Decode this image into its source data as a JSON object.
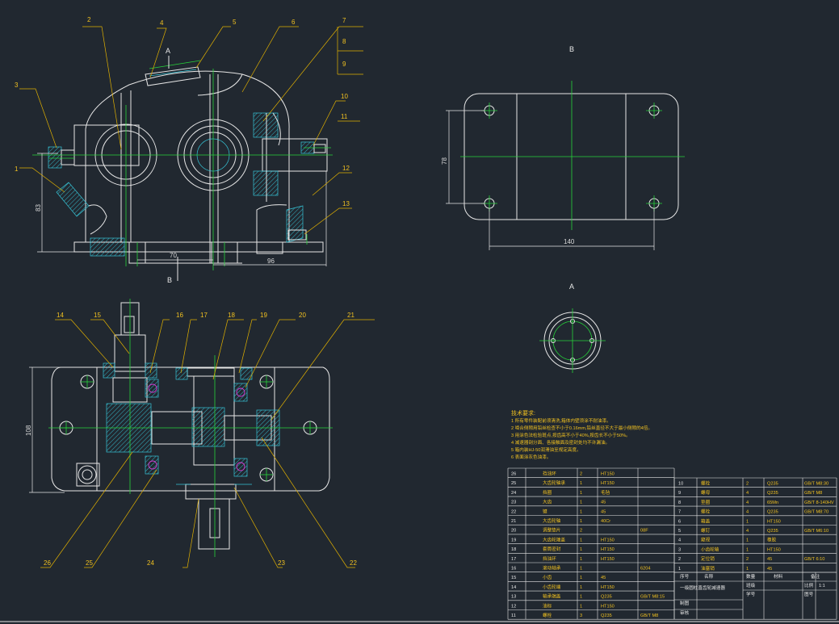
{
  "views": {
    "section_label_a": "A",
    "section_label_b": "B",
    "view_b_title": "B",
    "view_a_title": "A"
  },
  "front_view": {
    "part_numbers": [
      "1",
      "2",
      "3",
      "4",
      "5",
      "6",
      "7",
      "8",
      "9",
      "10",
      "11",
      "12",
      "13"
    ],
    "dimensions": {
      "height": "83",
      "base_left": "70",
      "base_right": "96"
    }
  },
  "view_b": {
    "dimensions": {
      "width": "140",
      "height": "78"
    }
  },
  "top_view": {
    "part_numbers": [
      "14",
      "15",
      "16",
      "17",
      "18",
      "19",
      "20",
      "21",
      "22",
      "23",
      "24",
      "25",
      "26"
    ],
    "dimensions": {
      "height": "108"
    }
  },
  "notes": {
    "title": "技术要求:",
    "lines": [
      "1 所有零件装配前须清洗,箱体内壁须涂不耐油漆。",
      "2 啮合侧隙用铅丝检查不小于0.16mm,铅丝直径不大于最小侧隙的4倍。",
      "3 用涂色法检验斑点,按齿高不小于40%,按齿长不小于50%。",
      "4 减速器剖分面、各接触面及密封处均不许漏油。",
      "5 箱内装HJ-50润滑油至规定高度。",
      "6 表面涂灰色油漆。"
    ]
  },
  "parts_list_left": [
    [
      "26",
      "挡油环",
      "2",
      "HT150",
      "",
      ""
    ],
    [
      "25",
      "大齿轮轴承",
      "1",
      "HT150",
      "",
      ""
    ],
    [
      "24",
      "挡圈",
      "1",
      "毛毡",
      "",
      ""
    ],
    [
      "23",
      "大齿",
      "1",
      "45",
      "",
      ""
    ],
    [
      "22",
      "键",
      "1",
      "45",
      "",
      ""
    ],
    [
      "21",
      "大齿轮轴",
      "1",
      "40Cr",
      "",
      ""
    ],
    [
      "20",
      "调整垫片",
      "2",
      "",
      "08F",
      ""
    ],
    [
      "19",
      "大齿轮端盖",
      "1",
      "HT150",
      "",
      ""
    ],
    [
      "18",
      "套筒密封",
      "1",
      "HT150",
      "",
      ""
    ],
    [
      "17",
      "挡油环",
      "1",
      "HT150",
      "",
      ""
    ],
    [
      "16",
      "滚动轴承",
      "1",
      "",
      "6204",
      ""
    ],
    [
      "15",
      "小齿",
      "1",
      "45",
      "",
      ""
    ],
    [
      "14",
      "小齿轮端",
      "1",
      "HT150",
      "",
      ""
    ],
    [
      "13",
      "轴承端盖",
      "1",
      "Q235",
      "GB/T M8:15",
      ""
    ],
    [
      "12",
      "油标",
      "1",
      "HT150",
      "",
      ""
    ],
    [
      "11",
      "螺栓",
      "3",
      "Q235",
      "GB/T M8",
      ""
    ]
  ],
  "parts_list_right": [
    [
      "10",
      "螺栓",
      "2",
      "Q235",
      "GB/T M8:30"
    ],
    [
      "9",
      "螺母",
      "4",
      "Q235",
      "GB/T M8"
    ],
    [
      "8",
      "垫圈",
      "4",
      "65Mn",
      "GB/T 8-140HV"
    ],
    [
      "7",
      "螺栓",
      "4",
      "Q235",
      "GB/T M8:70"
    ],
    [
      "6",
      "箱盖",
      "1",
      "HT150",
      ""
    ],
    [
      "5",
      "螺钉",
      "4",
      "Q235",
      "GB/T M6:10"
    ],
    [
      "4",
      "窥视",
      "1",
      "橡胶",
      ""
    ],
    [
      "3",
      "小齿轮轴",
      "1",
      "HT150",
      ""
    ],
    [
      "2",
      "定位销",
      "2",
      "45",
      "GB/T 6:10"
    ],
    [
      "1",
      "油塞销",
      "1",
      "45",
      ""
    ]
  ],
  "title_block": {
    "header": [
      "序号",
      "名称",
      "数量",
      "材料",
      "备注"
    ],
    "drawing_name": "一级圆柱直齿轮减速器",
    "ratio_label": "比例",
    "ratio_value": "1:1",
    "drawn_label": "制图",
    "check_label": "审核",
    "number_label": "学号",
    "class_label": "班级",
    "sheet_label": "图号"
  }
}
